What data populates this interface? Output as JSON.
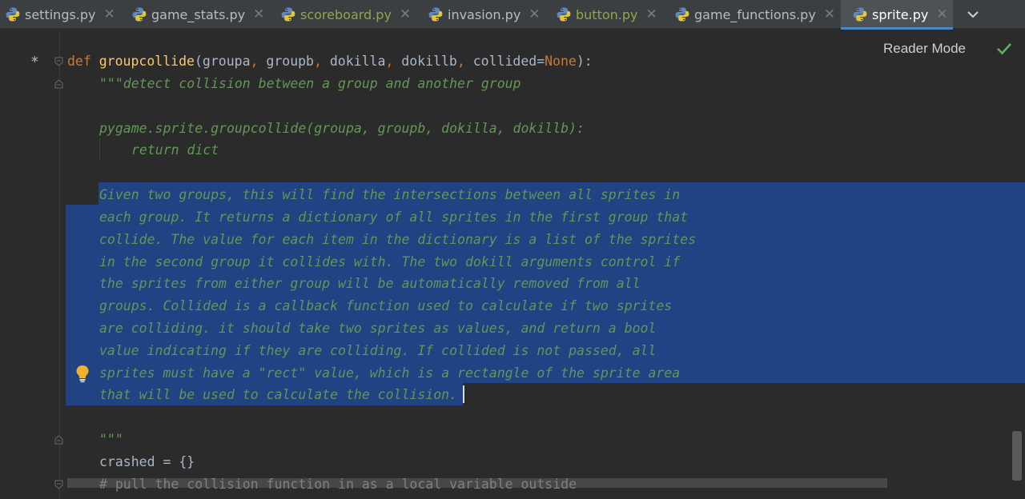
{
  "tabs": [
    {
      "label": "settings.py",
      "modified": false,
      "active": false
    },
    {
      "label": "game_stats.py",
      "modified": false,
      "active": false
    },
    {
      "label": "scoreboard.py",
      "modified": true,
      "active": false
    },
    {
      "label": "invasion.py",
      "modified": false,
      "active": false
    },
    {
      "label": "button.py",
      "modified": true,
      "active": false
    },
    {
      "label": "game_functions.py",
      "modified": false,
      "active": false
    },
    {
      "label": "sprite.py",
      "modified": false,
      "active": true
    }
  ],
  "tab_close_glyph": "✕",
  "reader_mode_label": "Reader Mode",
  "modified_marker": "*",
  "code": {
    "def_kw": "def",
    "func_name": "groupcollide",
    "open_paren": "(",
    "p1": "groupa",
    "c1": ",",
    "p2": "groupb",
    "c2": ",",
    "p3": "dokilla",
    "c3": ",",
    "p4": "dokillb",
    "c4": ",",
    "p5": "collided=",
    "none_kw": "None",
    "close": "):",
    "doc_first": "\"\"\"detect collision between a group and another group",
    "doc_call": "pygame.sprite.groupcollide(groupa, groupb, dokilla, dokillb):",
    "doc_return": "return dict",
    "doc_body": [
      "Given two groups, this will find the intersections between all sprites in",
      "each group. It returns a dictionary of all sprites in the first group that",
      "collide. The value for each item in the dictionary is a list of the sprites",
      "in the second group it collides with. The two dokill arguments control if",
      "the sprites from either group will be automatically removed from all",
      "groups. Collided is a callback function used to calculate if two sprites",
      "are colliding. it should take two sprites as values, and return a bool",
      "value indicating if they are colliding. If collided is not passed, all",
      "sprites must have a \"rect\" value, which is a rectangle of the sprite area",
      "that will be used to calculate the collision."
    ],
    "doc_close": "\"\"\"",
    "crashed_line": "crashed = {}",
    "comment_line": "# pull the collision function in as a local variable outside"
  },
  "colors": {
    "background": "#2b2b2b",
    "tabbar": "#3c3f41",
    "selection": "#214283",
    "keyword": "#cc7832",
    "function": "#ffc66d",
    "docstring": "#629755",
    "text": "#a9b7c6",
    "modified_tab": "#8da84a",
    "active_underline": "#4a88c7"
  },
  "icons": {
    "tab_file": "python-file-icon",
    "tabs_dropdown": "chevron-down-icon",
    "reader_check": "check-icon",
    "intention": "lightbulb-icon",
    "fold": "fold-icon"
  }
}
